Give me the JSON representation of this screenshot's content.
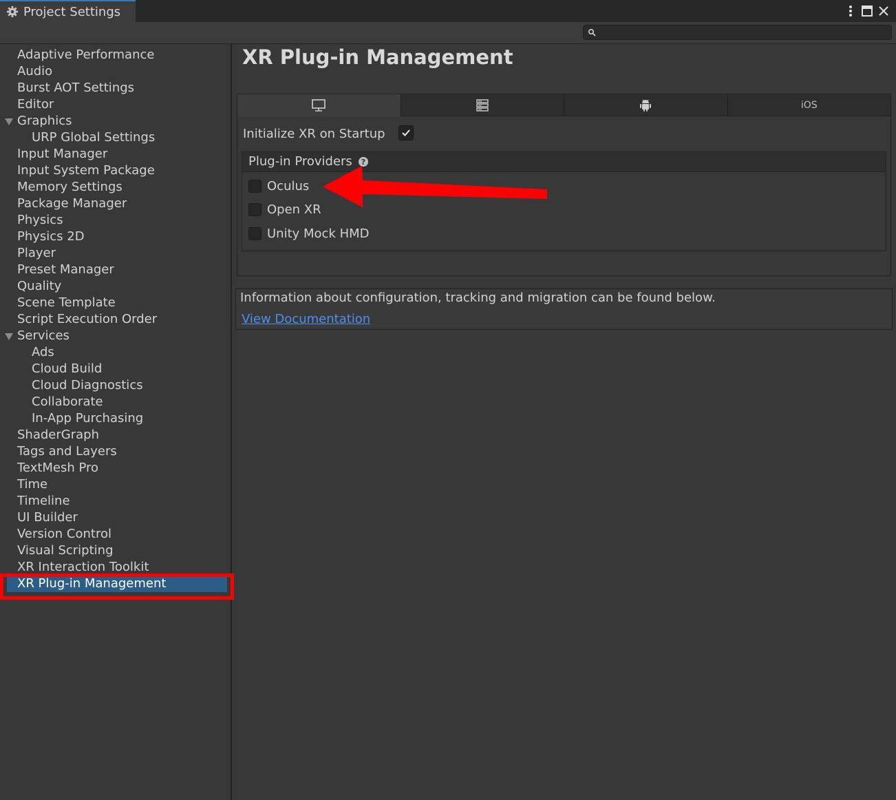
{
  "window": {
    "tab_title": "Project Settings",
    "controls": [
      "more-options",
      "maximize",
      "close"
    ]
  },
  "search": {
    "placeholder": "",
    "value": ""
  },
  "sidebar": {
    "selected": "XR Plug-in Management",
    "items": [
      {
        "label": "Adaptive Performance",
        "level": 0
      },
      {
        "label": "Audio",
        "level": 0
      },
      {
        "label": "Burst AOT Settings",
        "level": 0
      },
      {
        "label": "Editor",
        "level": 0
      },
      {
        "label": "Graphics",
        "level": 0,
        "expanded": true
      },
      {
        "label": "URP Global Settings",
        "level": 1
      },
      {
        "label": "Input Manager",
        "level": 0
      },
      {
        "label": "Input System Package",
        "level": 0
      },
      {
        "label": "Memory Settings",
        "level": 0
      },
      {
        "label": "Package Manager",
        "level": 0
      },
      {
        "label": "Physics",
        "level": 0
      },
      {
        "label": "Physics 2D",
        "level": 0
      },
      {
        "label": "Player",
        "level": 0
      },
      {
        "label": "Preset Manager",
        "level": 0
      },
      {
        "label": "Quality",
        "level": 0
      },
      {
        "label": "Scene Template",
        "level": 0
      },
      {
        "label": "Script Execution Order",
        "level": 0
      },
      {
        "label": "Services",
        "level": 0,
        "expanded": true
      },
      {
        "label": "Ads",
        "level": 1
      },
      {
        "label": "Cloud Build",
        "level": 1
      },
      {
        "label": "Cloud Diagnostics",
        "level": 1
      },
      {
        "label": "Collaborate",
        "level": 1
      },
      {
        "label": "In-App Purchasing",
        "level": 1
      },
      {
        "label": "ShaderGraph",
        "level": 0
      },
      {
        "label": "Tags and Layers",
        "level": 0
      },
      {
        "label": "TextMesh Pro",
        "level": 0
      },
      {
        "label": "Time",
        "level": 0
      },
      {
        "label": "Timeline",
        "level": 0
      },
      {
        "label": "UI Builder",
        "level": 0
      },
      {
        "label": "Version Control",
        "level": 0
      },
      {
        "label": "Visual Scripting",
        "level": 0
      },
      {
        "label": "XR Interaction Toolkit",
        "level": 0
      },
      {
        "label": "XR Plug-in Management",
        "level": 0,
        "selected": true
      }
    ]
  },
  "main": {
    "title": "XR Plug-in Management",
    "platform_tabs": [
      {
        "icon": "desktop-icon",
        "label": "",
        "active": true
      },
      {
        "icon": "server-icon",
        "label": "",
        "active": false
      },
      {
        "icon": "android-icon",
        "label": "",
        "active": false
      },
      {
        "icon": "",
        "label": "iOS",
        "active": false
      }
    ],
    "init_on_startup": {
      "label": "Initialize XR on Startup",
      "checked": true
    },
    "providers": {
      "title": "Plug-in Providers",
      "items": [
        {
          "label": "Oculus",
          "checked": false
        },
        {
          "label": "Open XR",
          "checked": false
        },
        {
          "label": "Unity Mock HMD",
          "checked": false
        }
      ]
    },
    "info": {
      "text": "Information about configuration, tracking and migration can be found below.",
      "link": "View Documentation"
    }
  },
  "annotations": {
    "highlight_color": "#ff0000",
    "arrow_color": "#ff0000"
  },
  "colors": {
    "background": "#383838",
    "titlebar": "#282828",
    "selection": "#2c5d87",
    "link": "#4c8ff0",
    "tab_accent": "#3a79bb"
  }
}
